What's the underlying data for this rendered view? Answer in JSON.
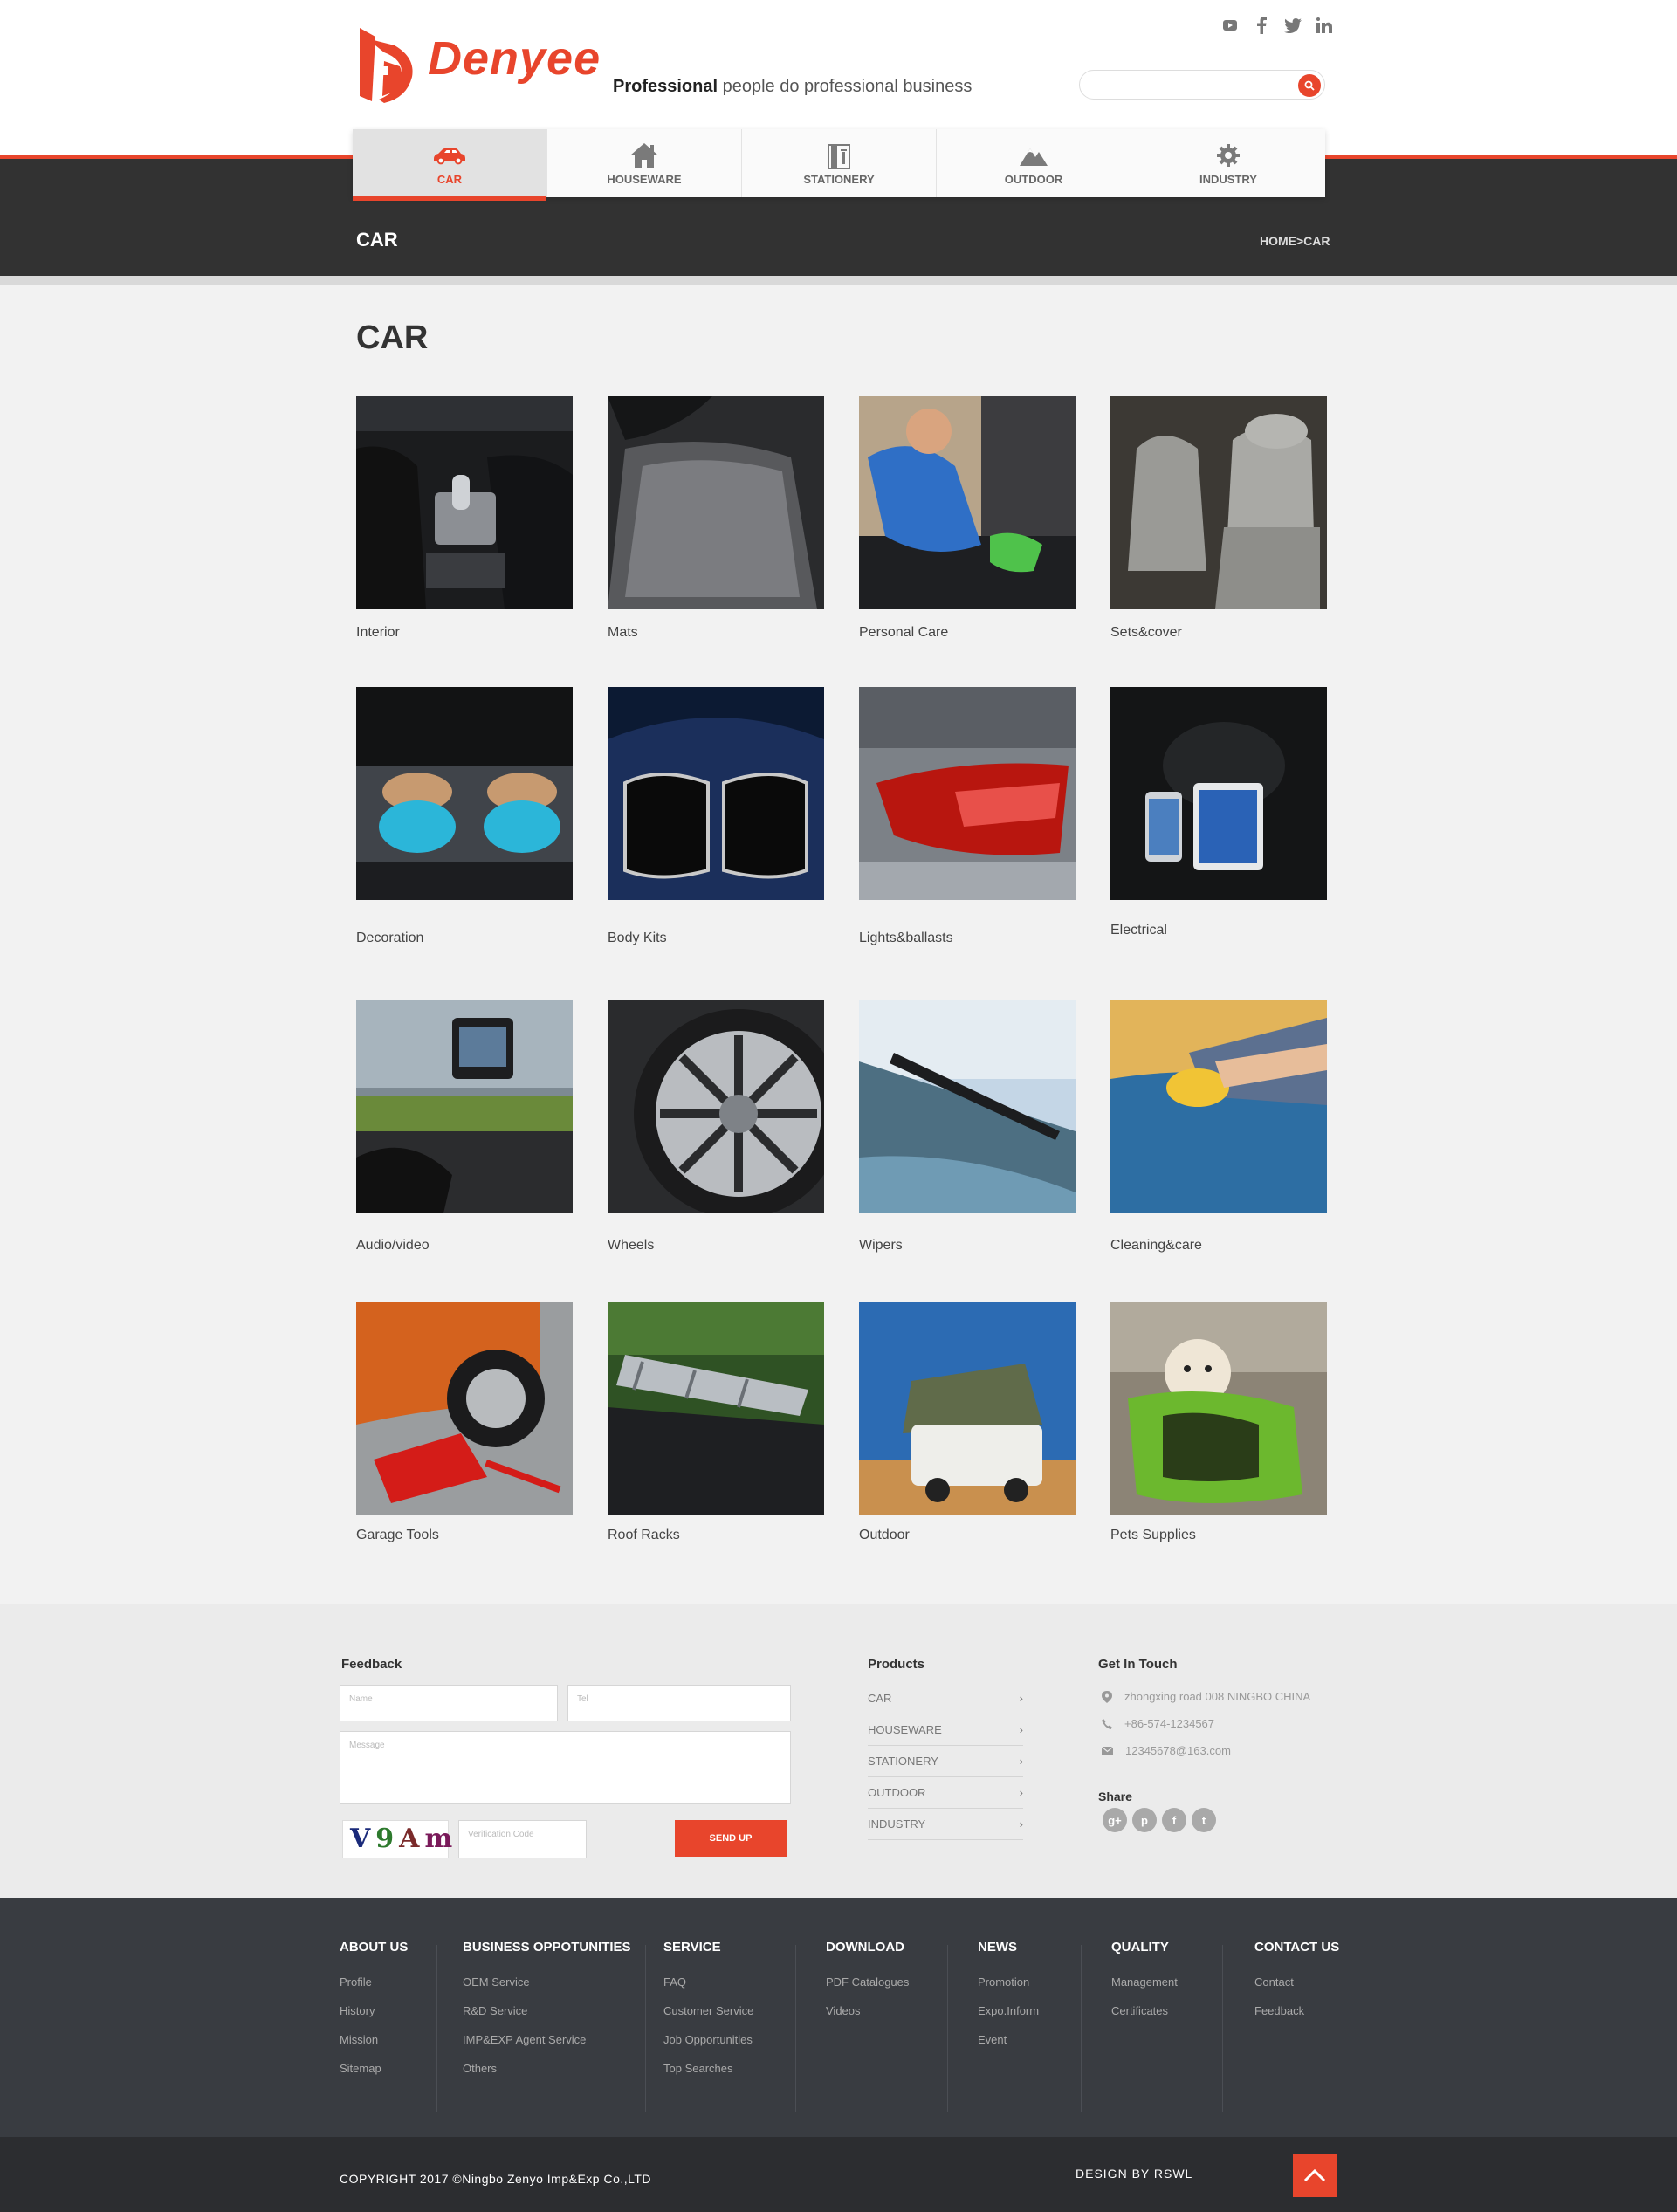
{
  "header": {
    "brand": "Denyee",
    "tagline_bold": "Professional",
    "tagline_rest": " people do professional business",
    "social": [
      "youtube-icon",
      "facebook-icon",
      "twitter-icon",
      "linkedin-icon"
    ],
    "search": {
      "value": "",
      "placeholder": ""
    }
  },
  "nav": {
    "items": [
      {
        "label": "CAR",
        "icon": "car-icon",
        "active": true
      },
      {
        "label": "HOUSEWARE",
        "icon": "house-icon",
        "active": false
      },
      {
        "label": "STATIONERY",
        "icon": "stationery-icon",
        "active": false
      },
      {
        "label": "OUTDOOR",
        "icon": "mountain-icon",
        "active": false
      },
      {
        "label": "INDUSTRY",
        "icon": "gear-icon",
        "active": false
      }
    ]
  },
  "band": {
    "title": "CAR",
    "breadcrumb": "HOME>CAR"
  },
  "main": {
    "title": "CAR"
  },
  "products": [
    {
      "label": "Interior"
    },
    {
      "label": "Mats"
    },
    {
      "label": "Personal Care"
    },
    {
      "label": "Sets&cover"
    },
    {
      "label": "Decoration"
    },
    {
      "label": "Body Kits"
    },
    {
      "label": "Lights&ballasts"
    },
    {
      "label": "Electrical"
    },
    {
      "label": "Audio/video"
    },
    {
      "label": "Wheels"
    },
    {
      "label": "Wipers"
    },
    {
      "label": "Cleaning&care"
    },
    {
      "label": "Garage Tools"
    },
    {
      "label": "Roof Racks"
    },
    {
      "label": "Outdoor"
    },
    {
      "label": "Pets Supplies"
    }
  ],
  "feedback": {
    "title": "Feedback",
    "name_placeholder": "Name",
    "tel_placeholder": "Tel",
    "message_placeholder": "Message",
    "captcha": "V9Am",
    "verification_placeholder": "Verification Code",
    "send_label": "SEND UP"
  },
  "products_panel": {
    "title": "Products",
    "links": [
      "CAR",
      "HOUSEWARE",
      "STATIONERY",
      "OUTDOOR",
      "INDUSTRY"
    ]
  },
  "contact": {
    "title": "Get In Touch",
    "address": "zhongxing road  008  NINGBO  CHINA",
    "phone": "+86-574-1234567",
    "email": "12345678@163.com",
    "share_title": "Share",
    "share": [
      "g+",
      "p",
      "f",
      "t"
    ]
  },
  "footer": {
    "columns": [
      {
        "title": "ABOUT US",
        "links": [
          "Profile",
          "History",
          "Mission",
          "Sitemap"
        ]
      },
      {
        "title": "BUSINESS OPPOTUNITIES",
        "links": [
          "OEM Service",
          "R&D Service",
          "IMP&EXP Agent Service",
          "Others"
        ]
      },
      {
        "title": "SERVICE",
        "links": [
          "FAQ",
          "Customer Service",
          "Job Opportunities",
          "Top Searches"
        ]
      },
      {
        "title": "DOWNLOAD",
        "links": [
          "PDF Catalogues",
          "Videos"
        ]
      },
      {
        "title": "NEWS",
        "links": [
          "Promotion",
          "Expo.Inform",
          "Event"
        ]
      },
      {
        "title": "QUALITY",
        "links": [
          "Management",
          "Certificates"
        ]
      },
      {
        "title": "CONTACT US",
        "links": [
          "Contact",
          "Feedback"
        ]
      }
    ],
    "copyright": "COPYRIGHT 2017 ©Ningbo Zenyo Imp&Exp Co.,LTD",
    "design": "DESIGN BY RSWL"
  },
  "colors": {
    "accent": "#e8452c",
    "dark_band": "#323232",
    "footer": "#393c41"
  }
}
